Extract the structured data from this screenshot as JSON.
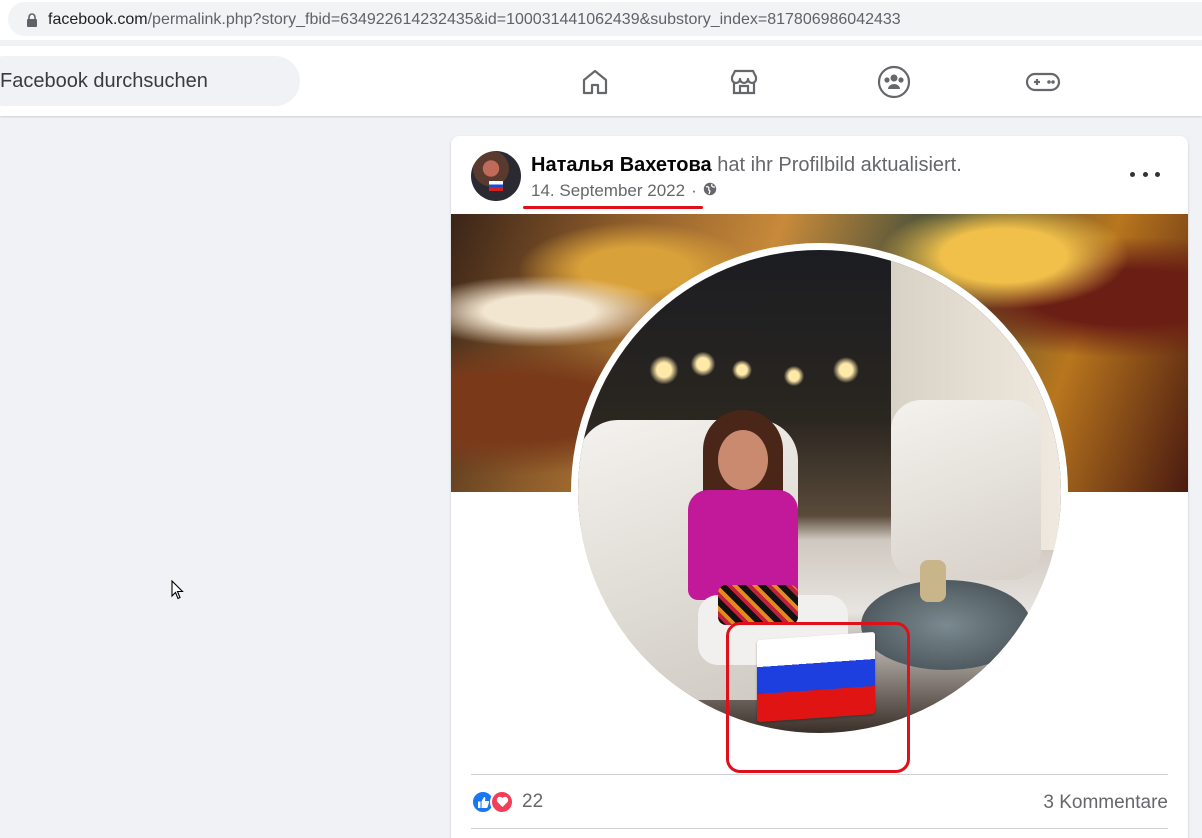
{
  "browser": {
    "url_host": "facebook.com",
    "url_path": "/permalink.php?story_fbid=634922614232435&id=100031441062439&substory_index=817806986042433",
    "lock_icon": "lock-icon"
  },
  "topnav": {
    "search_placeholder": "Facebook durchsuchen",
    "icons": [
      "home-icon",
      "marketplace-icon",
      "groups-icon",
      "gaming-icon"
    ]
  },
  "post": {
    "author": "Наталья Вахетова",
    "action": "hat ihr Profilbild aktualisiert.",
    "date": "14. September 2022",
    "separator": "·",
    "audience_icon": "globe-icon",
    "reaction_count": "22",
    "comments": "3 Kommentare",
    "reactions": [
      "like",
      "love"
    ]
  },
  "colors": {
    "annotation_red": "#e0101a",
    "fb_blue": "#1877f2",
    "love_red": "#f33e58",
    "flag_white": "#ffffff",
    "flag_blue": "#1e3fe0",
    "flag_red": "#e11414"
  }
}
